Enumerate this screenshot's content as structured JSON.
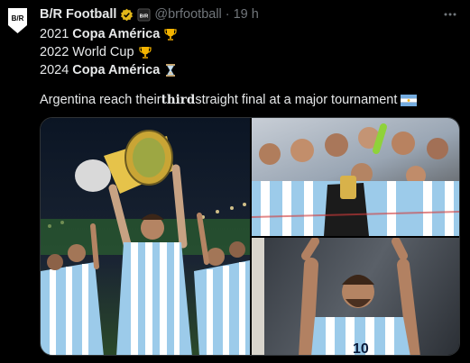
{
  "tweet": {
    "author_name": "B/R Football",
    "handle": "@brfootball",
    "separator": "·",
    "time": "19 h",
    "avatar_text": "B/R",
    "lines": [
      {
        "year": "2021",
        "title": "Copa América",
        "bold": true,
        "emoji": "trophy-icon"
      },
      {
        "year": "2022",
        "title": "World Cup",
        "bold": false,
        "emoji": "trophy-icon"
      },
      {
        "year": "2024",
        "title": "Copa América",
        "bold": true,
        "emoji": "hourglass-icon"
      }
    ],
    "message_pre": "Argentina reach their ",
    "message_em": "third",
    "message_post": " straight final at a major tournament",
    "flag_emoji": "argentina-flag-icon"
  },
  "media": {
    "photos": [
      "trophy-lift-photo",
      "team-celebration-photo",
      "messi-celebration-photo"
    ],
    "jersey_number": "10"
  },
  "colors": {
    "background": "#000000",
    "text": "#e7e9ea",
    "muted": "#71767b",
    "verified_gold": "#e2b719",
    "border": "#2f3336"
  }
}
